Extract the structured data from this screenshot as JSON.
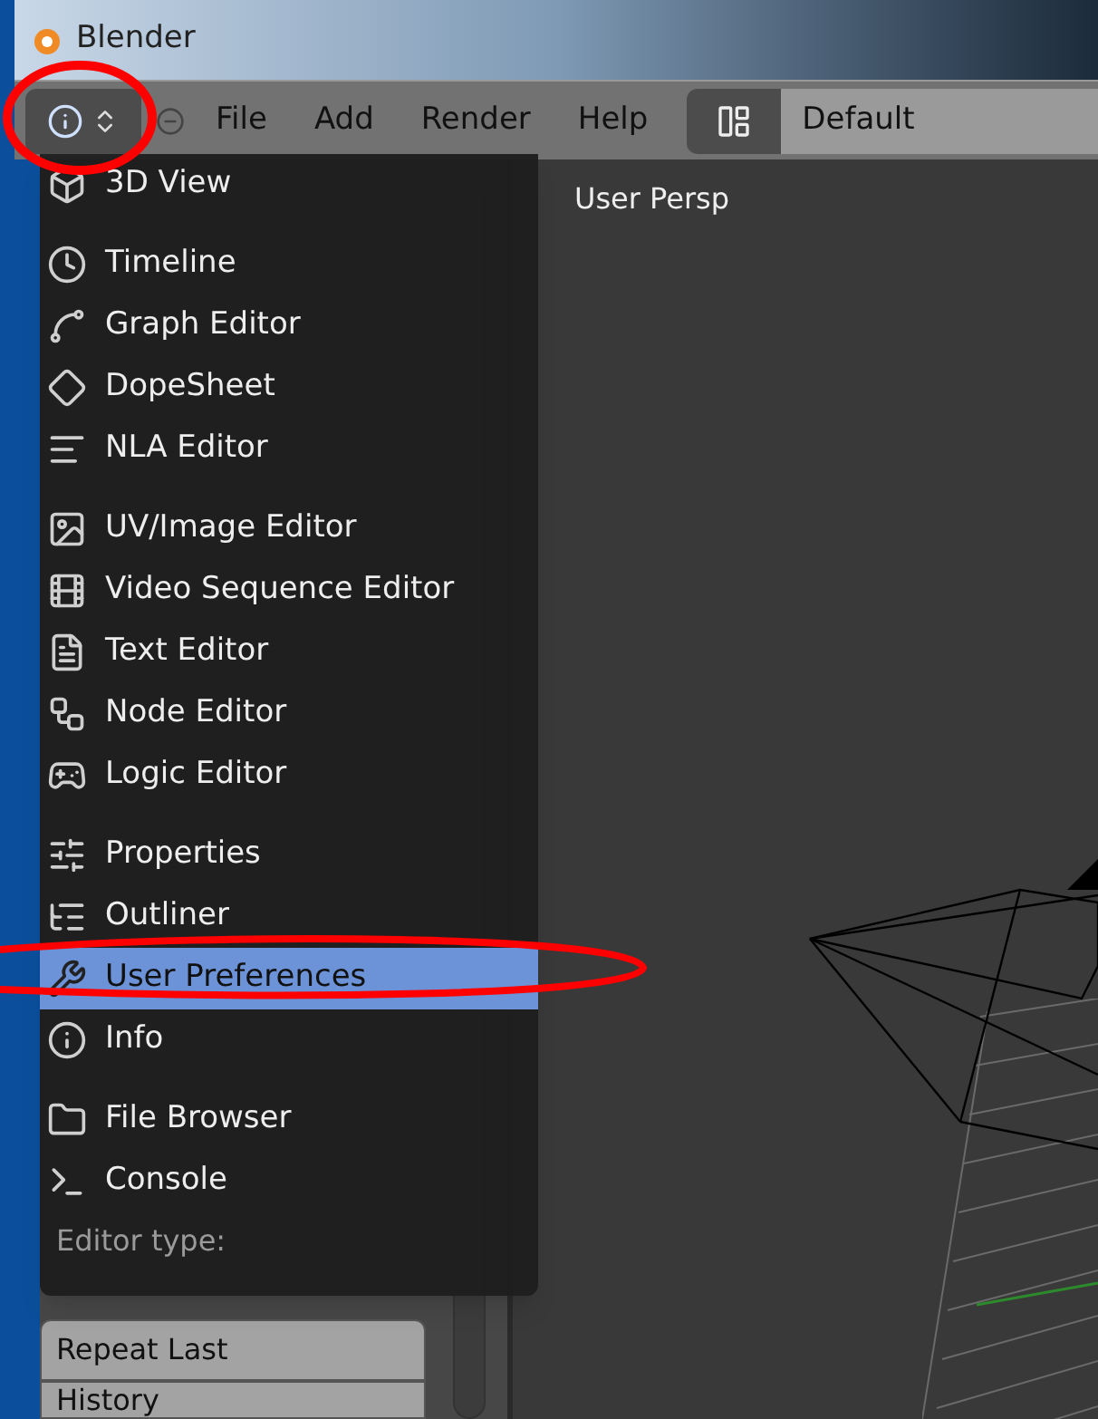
{
  "window": {
    "title": "Blender"
  },
  "header": {
    "menus": [
      "File",
      "Add",
      "Render",
      "Help"
    ],
    "layout": "Default"
  },
  "viewport": {
    "label": "User Persp"
  },
  "editor_menu": {
    "title": "Editor type:",
    "groups": [
      [
        {
          "label": "3D View",
          "selected": false
        }
      ],
      [
        {
          "label": "Timeline",
          "selected": false
        },
        {
          "label": "Graph Editor",
          "selected": false
        },
        {
          "label": "DopeSheet",
          "selected": false
        },
        {
          "label": "NLA Editor",
          "selected": false
        }
      ],
      [
        {
          "label": "UV/Image Editor",
          "selected": false
        },
        {
          "label": "Video Sequence Editor",
          "selected": false
        },
        {
          "label": "Text Editor",
          "selected": false
        },
        {
          "label": "Node Editor",
          "selected": false
        },
        {
          "label": "Logic Editor",
          "selected": false
        }
      ],
      [
        {
          "label": "Properties",
          "selected": false
        },
        {
          "label": "Outliner",
          "selected": false
        },
        {
          "label": "User Preferences",
          "selected": true
        },
        {
          "label": "Info",
          "selected": false
        }
      ],
      [
        {
          "label": "File Browser",
          "selected": false
        },
        {
          "label": "Console",
          "selected": false
        }
      ]
    ]
  },
  "tool_shelf": {
    "buttons": [
      "Repeat Last",
      "History"
    ]
  }
}
